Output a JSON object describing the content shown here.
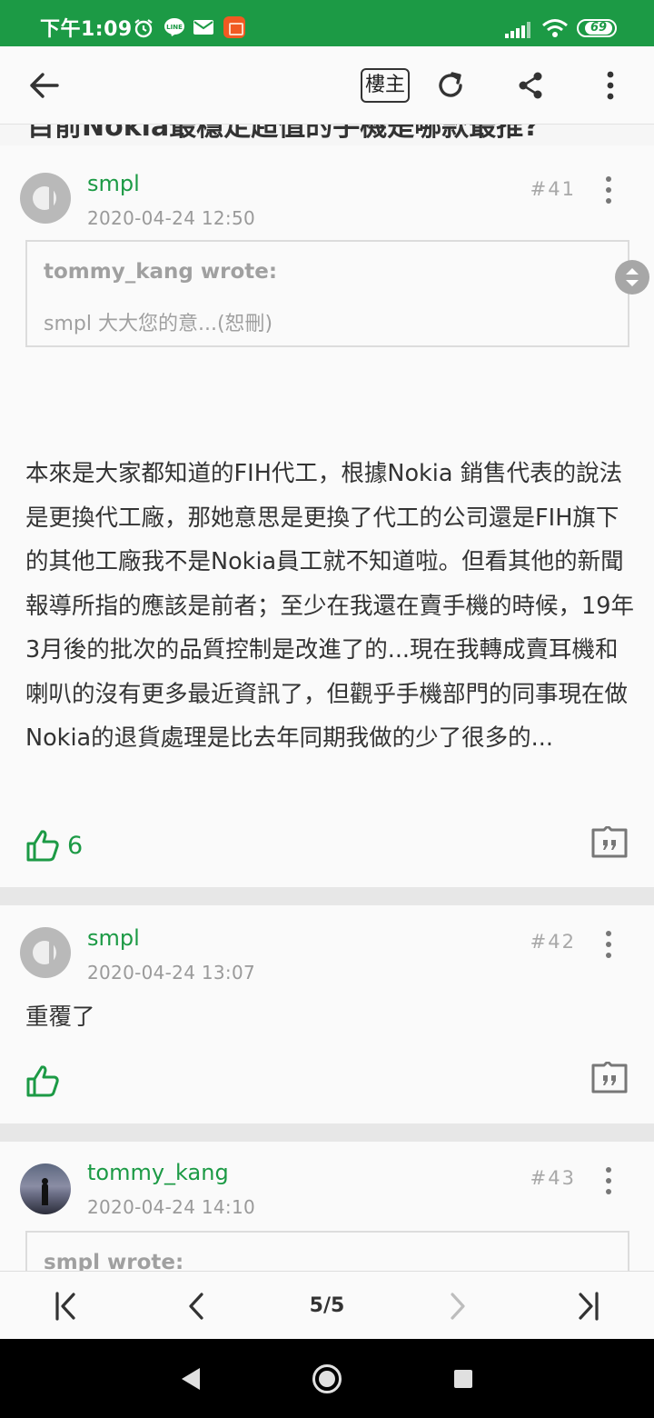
{
  "status_bar": {
    "time": "下午1:09",
    "battery": "69",
    "accent_color": "#1c9a45"
  },
  "toolbar": {
    "back_icon": "arrow-left-icon",
    "op_filter_label": "樓主",
    "refresh_icon": "refresh-icon",
    "share_icon": "share-icon",
    "more_icon": "more-vert-icon"
  },
  "thread": {
    "title": "目前Nokia最穩定超值的手機是哪款最推?"
  },
  "posts": [
    {
      "username": "smpl",
      "date": "2020-04-24 12:50",
      "floor": "#41",
      "quote": {
        "header": "tommy_kang wrote:",
        "body": "smpl 大大您的意...(恕刪)"
      },
      "content": "本來是大家都知道的FIH代工，根據Nokia 銷售代表的說法是更換代工廠，那她意思是更換了代工的公司還是FIH旗下的其他工廠我不是Nokia員工就不知道啦。但看其他的新聞報導所指的應該是前者；至少在我還在賣手機的時候，19年3月後的批次的品質控制是改進了的...現在我轉成賣耳機和喇叭的沒有更多最近資訊了，但觀乎手機部門的同事現在做Nokia的退貨處理是比去年同期我做的少了很多的...",
      "likes": "6"
    },
    {
      "username": "smpl",
      "date": "2020-04-24 13:07",
      "floor": "#42",
      "content": "重覆了"
    },
    {
      "username": "tommy_kang",
      "date": "2020-04-24 14:10",
      "floor": "#43",
      "quote": {
        "header": "smpl wrote:"
      }
    }
  ],
  "pager": {
    "current": "5/5",
    "first_icon": "first-page-icon",
    "prev_icon": "chevron-left-icon",
    "next_icon": "chevron-right-icon",
    "last_icon": "last-page-icon"
  }
}
